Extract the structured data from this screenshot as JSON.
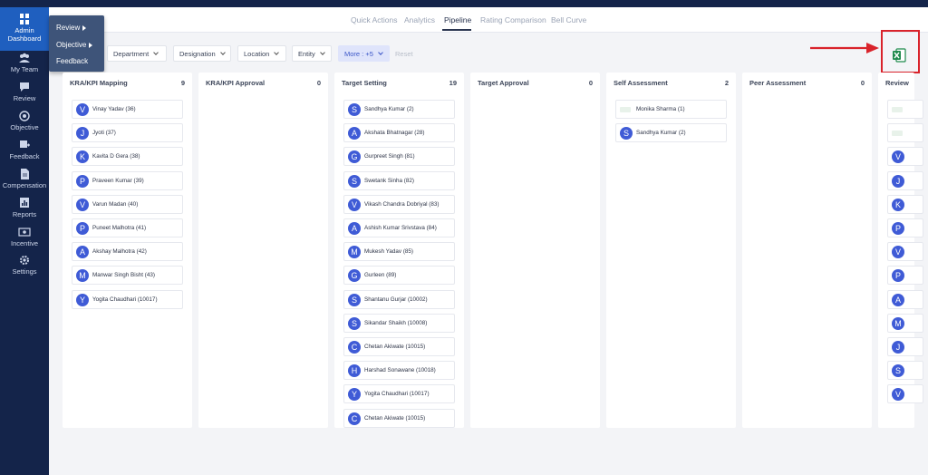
{
  "sidebar": {
    "items": [
      {
        "label": "Admin Dashboard",
        "icon": "dashboard-icon"
      },
      {
        "label": "My Team",
        "icon": "team-icon"
      },
      {
        "label": "Review",
        "icon": "review-icon"
      },
      {
        "label": "Objective",
        "icon": "objective-icon"
      },
      {
        "label": "Feedback",
        "icon": "feedback-icon"
      },
      {
        "label": "Compensation",
        "icon": "compensation-icon"
      },
      {
        "label": "Reports",
        "icon": "reports-icon"
      },
      {
        "label": "Incentive",
        "icon": "incentive-icon"
      },
      {
        "label": "Settings",
        "icon": "gear-icon"
      }
    ]
  },
  "flyout": {
    "items": [
      {
        "label": "Review"
      },
      {
        "label": "Objective"
      },
      {
        "label": "Feedback"
      }
    ]
  },
  "tabs": [
    {
      "label": "Quick Actions"
    },
    {
      "label": "Analytics"
    },
    {
      "label": "Pipeline"
    },
    {
      "label": "Rating Comparison"
    },
    {
      "label": "Bell Curve"
    }
  ],
  "filters": {
    "department": "Department",
    "designation": "Designation",
    "location": "Location",
    "entity": "Entity",
    "more": "More : +5",
    "reset": "Reset"
  },
  "excel": {
    "icon": "excel-export-icon"
  },
  "columns": [
    {
      "title": "KRA/KPI Mapping",
      "count": "9",
      "cards": [
        {
          "initial": "V",
          "name": "Vinay Yadav (36)"
        },
        {
          "initial": "J",
          "name": "Jyoti (37)"
        },
        {
          "initial": "K",
          "name": "Kavita D Gera (38)"
        },
        {
          "initial": "P",
          "name": "Praveen Kumar (39)"
        },
        {
          "initial": "V",
          "name": "Varun Madan (40)"
        },
        {
          "initial": "P",
          "name": "Puneet Malhotra (41)"
        },
        {
          "initial": "A",
          "name": "Akshay Malhotra (42)"
        },
        {
          "initial": "M",
          "name": "Manwar Singh Bisht (43)"
        },
        {
          "initial": "Y",
          "name": "Yogita Chaudhari (10017)"
        }
      ]
    },
    {
      "title": "KRA/KPI Approval",
      "count": "0",
      "cards": []
    },
    {
      "title": "Target Setting",
      "count": "19",
      "cards": [
        {
          "initial": "S",
          "name": "Sandhya Kumar (2)"
        },
        {
          "initial": "A",
          "name": "Akshata Bhatnagar (28)"
        },
        {
          "initial": "G",
          "name": "Gurpreet Singh (81)"
        },
        {
          "initial": "S",
          "name": "Swetank Sinha (82)"
        },
        {
          "initial": "V",
          "name": "Vikash Chandra Dobriyal (83)"
        },
        {
          "initial": "A",
          "name": "Ashish Kumar Srivstava (84)"
        },
        {
          "initial": "M",
          "name": "Mukesh Yadav (85)"
        },
        {
          "initial": "G",
          "name": "Gurleen (89)"
        },
        {
          "initial": "S",
          "name": "Shantanu Gurjar (10002)"
        },
        {
          "initial": "S",
          "name": "Sikandar Shaikh (10008)"
        },
        {
          "initial": "C",
          "name": "Chetan Akiwate (10015)"
        },
        {
          "initial": "H",
          "name": "Harshad Sonawane (10018)"
        },
        {
          "initial": "Y",
          "name": "Yogita Chaudhari (10017)"
        },
        {
          "initial": "C",
          "name": "Chetan Akiwate (10015)"
        }
      ]
    },
    {
      "title": "Target Approval",
      "count": "0",
      "cards": []
    },
    {
      "title": "Self Assessment",
      "count": "2",
      "cards": [
        {
          "initial": "",
          "name": "Monika Sharma (1)",
          "logo": true
        },
        {
          "initial": "S",
          "name": "Sandhya Kumar (2)"
        }
      ]
    },
    {
      "title": "Peer Assessment",
      "count": "0",
      "cards": []
    },
    {
      "title": "Review",
      "count": "",
      "cards": [
        {
          "initial": "",
          "name": "",
          "logo": true
        },
        {
          "initial": "",
          "name": "",
          "logo": true
        },
        {
          "initial": "V",
          "name": ""
        },
        {
          "initial": "J",
          "name": ""
        },
        {
          "initial": "K",
          "name": ""
        },
        {
          "initial": "P",
          "name": ""
        },
        {
          "initial": "V",
          "name": ""
        },
        {
          "initial": "P",
          "name": ""
        },
        {
          "initial": "A",
          "name": ""
        },
        {
          "initial": "M",
          "name": ""
        },
        {
          "initial": "J",
          "name": ""
        },
        {
          "initial": "S",
          "name": ""
        },
        {
          "initial": "V",
          "name": ""
        }
      ]
    }
  ]
}
